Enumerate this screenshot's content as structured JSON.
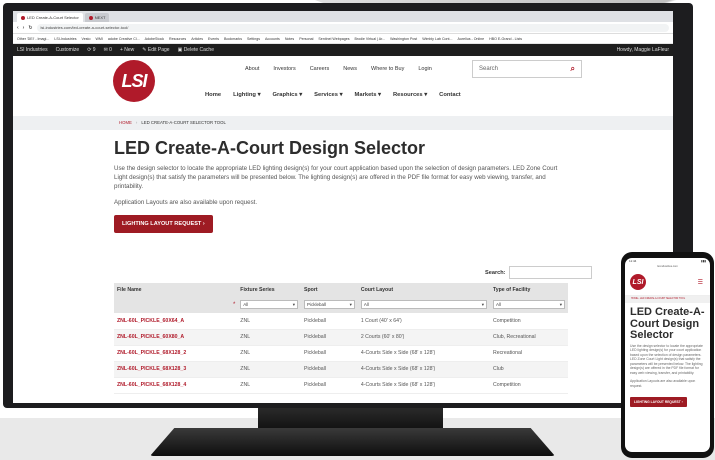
{
  "browser": {
    "tabs": [
      {
        "label": "LED Create-A-Court Selector"
      },
      {
        "label": "NEXT"
      }
    ],
    "url": "lsi-industries.com/led-create-a-court-selector-tool/",
    "bookmarks": [
      "Other 'DEI' - Imagi...",
      "LSI-Industries",
      "Vesto",
      "WMI",
      "adobe Creative Cl...",
      "AdobeStock",
      "Resources",
      "Articles",
      "Events",
      "Bookmarks",
      "Settings",
      "Accounts",
      "Notes",
      "Personal",
      "Sentinel Webpages",
      "Brodie Virtual | Ar...",
      "Washington Post",
      "Wimbly Lab Cont...",
      "Aurelius - Online",
      "HBO E-Grand - Lists"
    ]
  },
  "wp_admin": {
    "site_name": "LSI Industries",
    "customize": "Customize",
    "updates": "9",
    "comments": "0",
    "new": "New",
    "edit_page": "Edit Page",
    "delete_cache": "Delete Cache",
    "greeting": "Howdy, Maggie LaFleur"
  },
  "header": {
    "logo_text": "LSI",
    "top_nav": [
      "About",
      "Investors",
      "Careers",
      "News",
      "Where to Buy",
      "Login"
    ],
    "search_placeholder": "Search",
    "main_nav": [
      "Home",
      "Lighting ▾",
      "Graphics ▾",
      "Services ▾",
      "Markets ▾",
      "Resources ▾",
      "Contact"
    ]
  },
  "breadcrumb": {
    "home": "HOME",
    "sep": "›",
    "current": "LED CREATE-A-COURT SELECTOR TOOL"
  },
  "main": {
    "title": "LED Create-A-Court Design Selector",
    "intro": "Use the design selector to locate the appropriate LED lighting design(s) for your court application based upon the selection of design parameters. LED Zone Court Light design(s) that satisfy the parameters will be presented below. The lighting design(s) are offered in the PDF file format for easy web viewing, transfer, and printability.",
    "apps": "Application Layouts are also available upon request.",
    "request_button": "LIGHTING LAYOUT REQUEST ›"
  },
  "table": {
    "search_label": "Search:",
    "columns": [
      "File Name",
      "Fixture Series",
      "Sport",
      "Court Layout",
      "Type of Facility"
    ],
    "filters": [
      "",
      "All",
      "Pickleball",
      "All",
      "All"
    ],
    "rows": [
      [
        "ZNL-60L_PICKLE_60X64_A",
        "ZNL",
        "Pickleball",
        "1 Court (40' x 64')",
        "Competition"
      ],
      [
        "ZNL-60L_PICKLE_60X80_A",
        "ZNL",
        "Pickleball",
        "2 Courts (60' x 80')",
        "Club, Recreational"
      ],
      [
        "ZNL-60L_PICKLE_68X128_2",
        "ZNL",
        "Pickleball",
        "4-Courts Side x Side (68' x 128')",
        "Recreational"
      ],
      [
        "ZNL-60L_PICKLE_68X128_3",
        "ZNL",
        "Pickleball",
        "4-Courts Side x Side (68' x 128')",
        "Club"
      ],
      [
        "ZNL-60L_PICKLE_68X128_4",
        "ZNL",
        "Pickleball",
        "4-Courts Side x Side (68' x 128')",
        "Competition"
      ]
    ]
  },
  "phone": {
    "time": "11:44",
    "url": "lsi-industries.com",
    "breadcrumb": "HOME › LED CREATE-A-COURT SELECTOR TOOL",
    "title": "LED Create-A-Court Design Selector",
    "intro": "Use the design selector to locate the appropriate LED lighting design(s) for your court application based upon the selection of design parameters. LED Zone Court Light design(s) that satisfy the parameters will be presented below. The lighting design(s) are offered in the PDF file format for easy web viewing, transfer, and printability.",
    "apps": "Application Layouts are also available upon request.",
    "button": "LIGHTING LAYOUT REQUEST ›"
  }
}
